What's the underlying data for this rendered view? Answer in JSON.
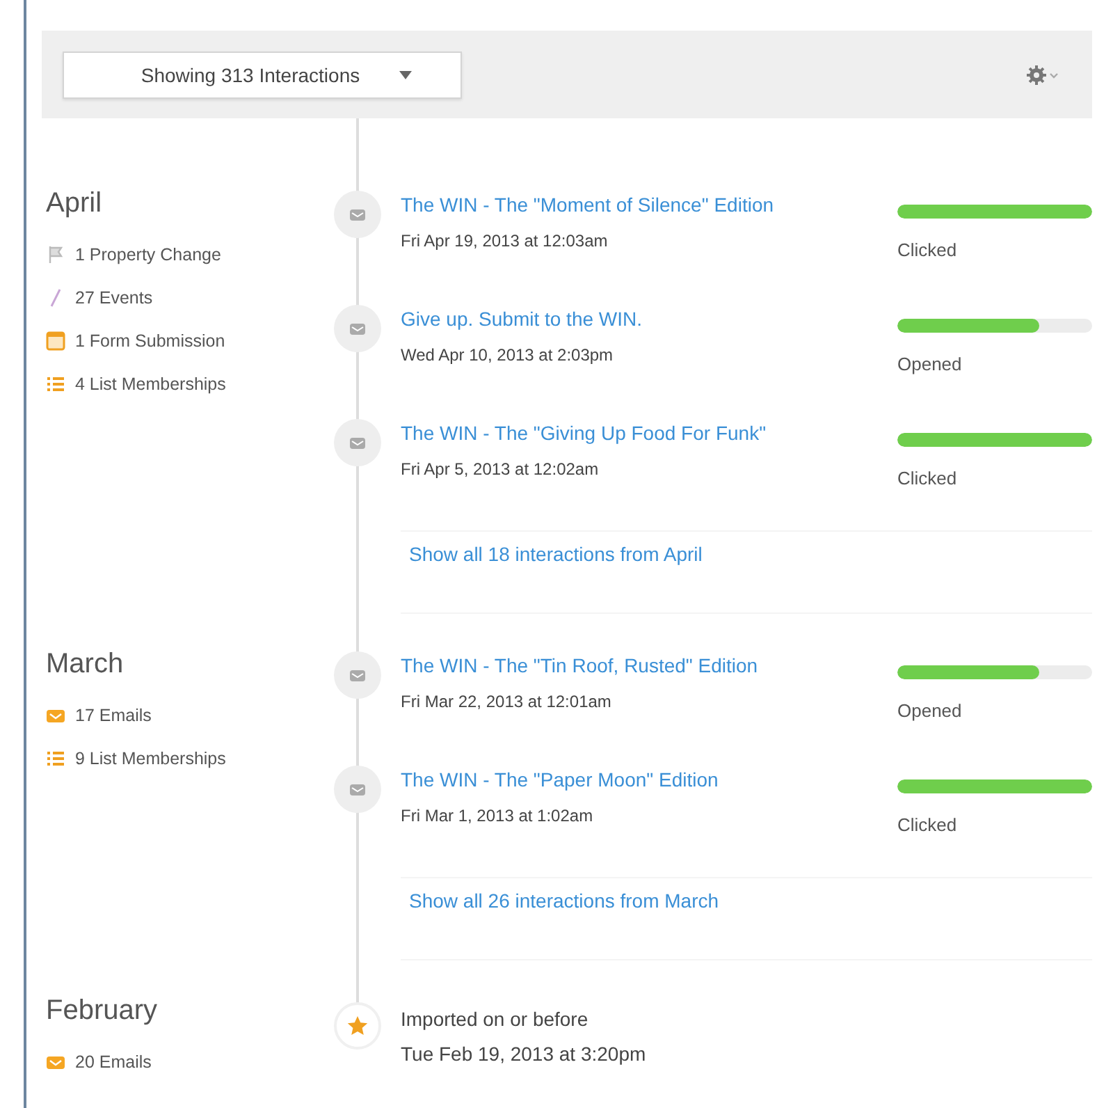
{
  "toolbar": {
    "filter": "Showing 313 Interactions"
  },
  "months": [
    {
      "name": "April",
      "stats": [
        {
          "kind": "flag",
          "label": "1 Property Change"
        },
        {
          "kind": "pencil",
          "label": "27 Events"
        },
        {
          "kind": "form",
          "label": "1 Form Submission"
        },
        {
          "kind": "list",
          "label": "4 List Memberships"
        }
      ],
      "interactions": [
        {
          "kind": "email",
          "title": "The WIN - The \"Moment of Silence\" Edition",
          "date": "Fri Apr 19, 2013 at 12:03am",
          "status": "Clicked",
          "level": 1
        },
        {
          "kind": "email",
          "title": "Give up. Submit to the WIN.",
          "date": "Wed Apr 10, 2013 at 2:03pm",
          "status": "Opened",
          "level": 0.73
        },
        {
          "kind": "email",
          "title": "The WIN - The \"Giving Up Food For Funk\"",
          "date": "Fri Apr 5, 2013 at 12:02am",
          "status": "Clicked",
          "level": 1
        },
        {
          "kind": "more",
          "title": "Show all 18 interactions from April"
        }
      ]
    },
    {
      "name": "March",
      "stats": [
        {
          "kind": "email",
          "label": "17 Emails"
        },
        {
          "kind": "list",
          "label": "9 List Memberships"
        }
      ],
      "interactions": [
        {
          "kind": "email",
          "title": "The WIN - The \"Tin Roof, Rusted\" Edition",
          "date": "Fri Mar 22, 2013 at 12:01am",
          "status": "Opened",
          "level": 0.73
        },
        {
          "kind": "email",
          "title": "The WIN - The \"Paper Moon\" Edition",
          "date": "Fri Mar 1, 2013 at 1:02am",
          "status": "Clicked",
          "level": 1
        },
        {
          "kind": "more",
          "title": "Show all 26 interactions from March"
        }
      ]
    },
    {
      "name": "February",
      "stats": [
        {
          "kind": "email",
          "label": "20 Emails"
        }
      ],
      "interactions": [
        {
          "kind": "import",
          "title": "Imported on or before",
          "date": "Tue Feb 19, 2013 at 3:20pm"
        }
      ]
    }
  ]
}
